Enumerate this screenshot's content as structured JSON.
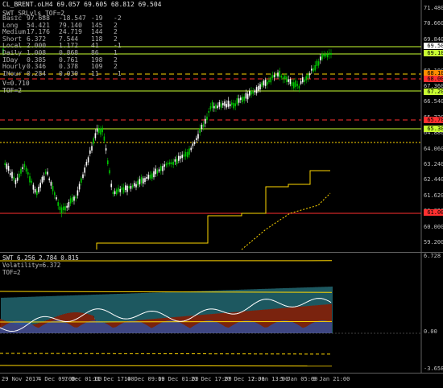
{
  "window": {
    "title": "CL_BRENT.oLH4 69.057 69.605 68.812 69.504"
  },
  "stats": [
    [
      "Basic",
      "97.688",
      "-18.547",
      "-19",
      "-2"
    ],
    [
      "Long",
      "54.421",
      "79.140",
      "145",
      "2"
    ],
    [
      "Medium",
      "17.176",
      "24.719",
      "144",
      "2"
    ],
    [
      "Short",
      "6.372",
      "7.544",
      "118",
      "2"
    ],
    [
      "Local",
      "2.000",
      "1.172",
      "41",
      "-1"
    ],
    [
      "Daily",
      "1.008",
      "0.868",
      "86",
      "1"
    ],
    [
      "IDay",
      "0.385",
      "0.761",
      "198",
      "2"
    ],
    [
      "Hourly",
      "0.346",
      "0.378",
      "109",
      "2"
    ],
    [
      "IHour",
      "0.284",
      "0.030",
      "11",
      "-1"
    ]
  ],
  "indicator_labels": {
    "name": "SWT_SRLvls_TOF=2",
    "v": "V=0.710",
    "tof": "TOF=2"
  },
  "main_axis": {
    "ticks": [
      "71.480",
      "70.660",
      "69.840",
      "69.0",
      "68.180",
      "67.360",
      "66.540",
      "65.720",
      "64.880",
      "64.060",
      "63.240",
      "62.440",
      "61.620",
      "60.820",
      "60.000",
      "59.200"
    ]
  },
  "price_tags": {
    "p1": {
      "text": "69.504",
      "color": "#ffffff"
    },
    "p2": {
      "text": "69.100",
      "color": "#c8ff32"
    },
    "p3": {
      "text": "68.100",
      "color": "#ff8c00"
    },
    "p4": {
      "text": "68.000",
      "color": "#ff3030"
    },
    "p5": {
      "text": "67.200",
      "color": "#c8ff32"
    },
    "p6": {
      "text": "65.700",
      "color": "#ff3030"
    },
    "p7": {
      "text": "65.300",
      "color": "#c8ff32"
    },
    "p8": {
      "text": "61.000",
      "color": "#ff3030"
    }
  },
  "indicator": {
    "title": "SWT 6.256 2.784 0.815",
    "volatility": "Volatility=6.372",
    "tof": "TOF=2",
    "ticks": [
      "6.728",
      "0.00",
      "-3.658"
    ]
  },
  "time_axis": [
    "29 Nov 2017",
    "4 Dec 09:00",
    "7 Dec 01:00",
    "11 Dec 17:00",
    "14 Dec 09:00",
    "19 Dec 01:00",
    "21 Dec 17:00",
    "27 Dec 17:00",
    "2 Jan 13:00",
    "5 Jan 05:00",
    "9 Jan 21:00"
  ],
  "colors": {
    "bull": "#00c800",
    "bear": "#ffffff",
    "yellow": "#ffd700",
    "lime": "#c8ff32",
    "red": "#ff3030",
    "cyan": "#3ab0c0"
  }
}
